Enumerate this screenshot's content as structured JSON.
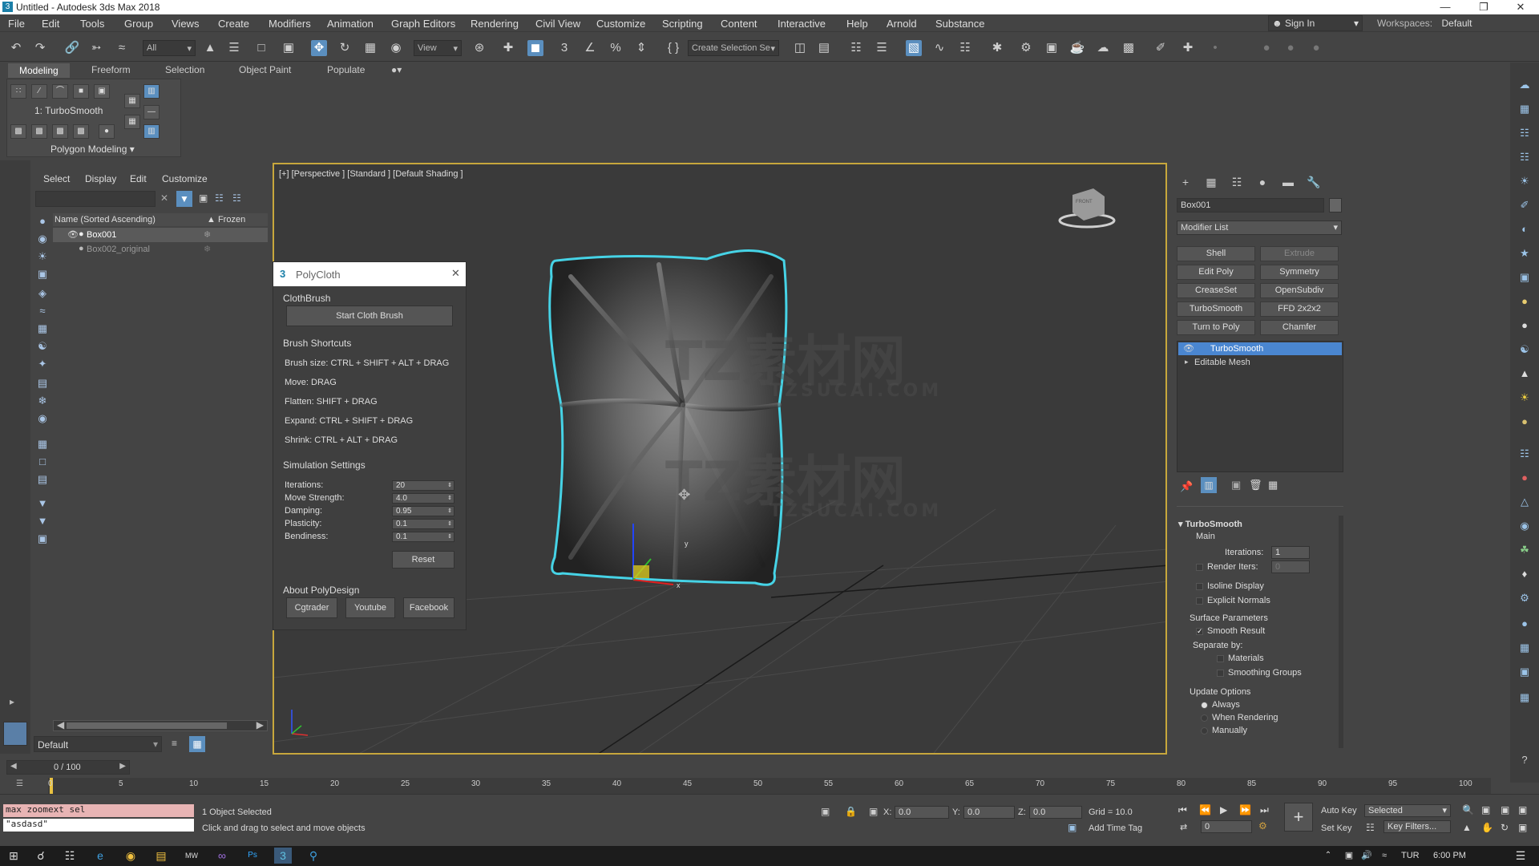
{
  "window": {
    "title": "Untitled - Autodesk 3ds Max 2018",
    "app_icon": "3"
  },
  "menu": [
    "File",
    "Edit",
    "Tools",
    "Group",
    "Views",
    "Create",
    "Modifiers",
    "Animation",
    "Graph Editors",
    "Rendering",
    "Civil View",
    "Customize",
    "Scripting",
    "Content",
    "Interactive",
    "Help",
    "Arnold",
    "Substance"
  ],
  "account": {
    "sign_in": "Sign In",
    "workspaces_label": "Workspaces:",
    "workspace": "Default"
  },
  "toolbar": {
    "filter": "All",
    "view": "View",
    "selection_set": "Create Selection Se"
  },
  "ribbon": {
    "tabs": [
      "Modeling",
      "Freeform",
      "Selection",
      "Object Paint",
      "Populate"
    ],
    "modifier_label": "1: TurboSmooth",
    "panel_label": "Polygon Modeling"
  },
  "scene_explorer": {
    "tabs": [
      "Select",
      "Display",
      "Edit",
      "Customize"
    ],
    "col_name": "Name (Sorted Ascending)",
    "col_frozen": "Frozen",
    "rows": [
      {
        "name": "Box001",
        "selected": true
      },
      {
        "name": "Box002_original",
        "selected": false
      }
    ],
    "layer": "Default"
  },
  "viewport": {
    "label": "[+] [Perspective ] [Standard ] [Default Shading ]",
    "watermark_cn": "TZ素材网",
    "watermark_en": "TZSUCAI.COM",
    "axis_x": "x",
    "axis_y": "y",
    "cube_label": "FRONT"
  },
  "polycloth": {
    "title": "PolyCloth",
    "clothbrush_header": "ClothBrush",
    "start_button": "Start Cloth Brush",
    "shortcuts_header": "Brush Shortcuts",
    "shortcuts": [
      "Brush size: CTRL + SHIFT + ALT + DRAG",
      "Move: DRAG",
      "Flatten: SHIFT + DRAG",
      "Expand: CTRL + SHIFT + DRAG",
      "Shrink: CTRL + ALT + DRAG"
    ],
    "sim_header": "Simulation Settings",
    "settings": [
      {
        "label": "Iterations:",
        "value": "20"
      },
      {
        "label": "Move Strength:",
        "value": "4.0"
      },
      {
        "label": "Damping:",
        "value": "0.95"
      },
      {
        "label": "Plasticity:",
        "value": "0.1"
      },
      {
        "label": "Bendiness:",
        "value": "0.1"
      }
    ],
    "reset": "Reset",
    "about_header": "About PolyDesign",
    "links": [
      "Cgtrader",
      "Youtube",
      "Facebook"
    ]
  },
  "command_panel": {
    "object_name": "Box001",
    "modifier_list": "Modifier List",
    "modifier_buttons": [
      "Shell",
      "Extrude",
      "Edit Poly",
      "Symmetry",
      "CreaseSet",
      "OpenSubdiv",
      "TurboSmooth",
      "FFD 2x2x2",
      "Turn to Poly",
      "Chamfer"
    ],
    "stack": [
      "TurboSmooth",
      "Editable Mesh"
    ],
    "rollout": {
      "title": "TurboSmooth",
      "main": "Main",
      "iterations_label": "Iterations:",
      "iterations": "1",
      "render_iters_label": "Render Iters:",
      "render_iters": "0",
      "isoline": "Isoline Display",
      "explicit_normals": "Explicit Normals",
      "surface_params": "Surface Parameters",
      "smooth_result": "Smooth Result",
      "separate_by": "Separate by:",
      "materials": "Materials",
      "smoothing_groups": "Smoothing Groups",
      "update_options": "Update Options",
      "always": "Always",
      "when_rendering": "When Rendering",
      "manually": "Manually"
    }
  },
  "timeline": {
    "frame": "0 / 100",
    "ticks": [
      "0",
      "5",
      "10",
      "15",
      "20",
      "25",
      "30",
      "35",
      "40",
      "45",
      "50",
      "55",
      "60",
      "65",
      "70",
      "75",
      "80",
      "85",
      "90",
      "95",
      "100"
    ]
  },
  "status": {
    "maxscript1": "max zoomext sel",
    "maxscript2": "\"asdasd\"",
    "selected": "1 Object Selected",
    "prompt": "Click and drag to select and move objects",
    "x_label": "X:",
    "x": "0.0",
    "y_label": "Y:",
    "y": "0.0",
    "z_label": "Z:",
    "z": "0.0",
    "grid": "Grid = 10.0",
    "add_time_tag": "Add Time Tag",
    "auto_key": "Auto Key",
    "set_key": "Set Key",
    "selected_dropdown": "Selected",
    "key_filters": "Key Filters...",
    "frame_field": "0"
  },
  "taskbar": {
    "lang": "TUR",
    "time": "6:00 PM"
  },
  "colors": {
    "accent": "#5b8fbf",
    "viewport_border": "#c7a73c",
    "cloth_outline": "#46d3e6",
    "stack_selected": "#4a86d0"
  }
}
